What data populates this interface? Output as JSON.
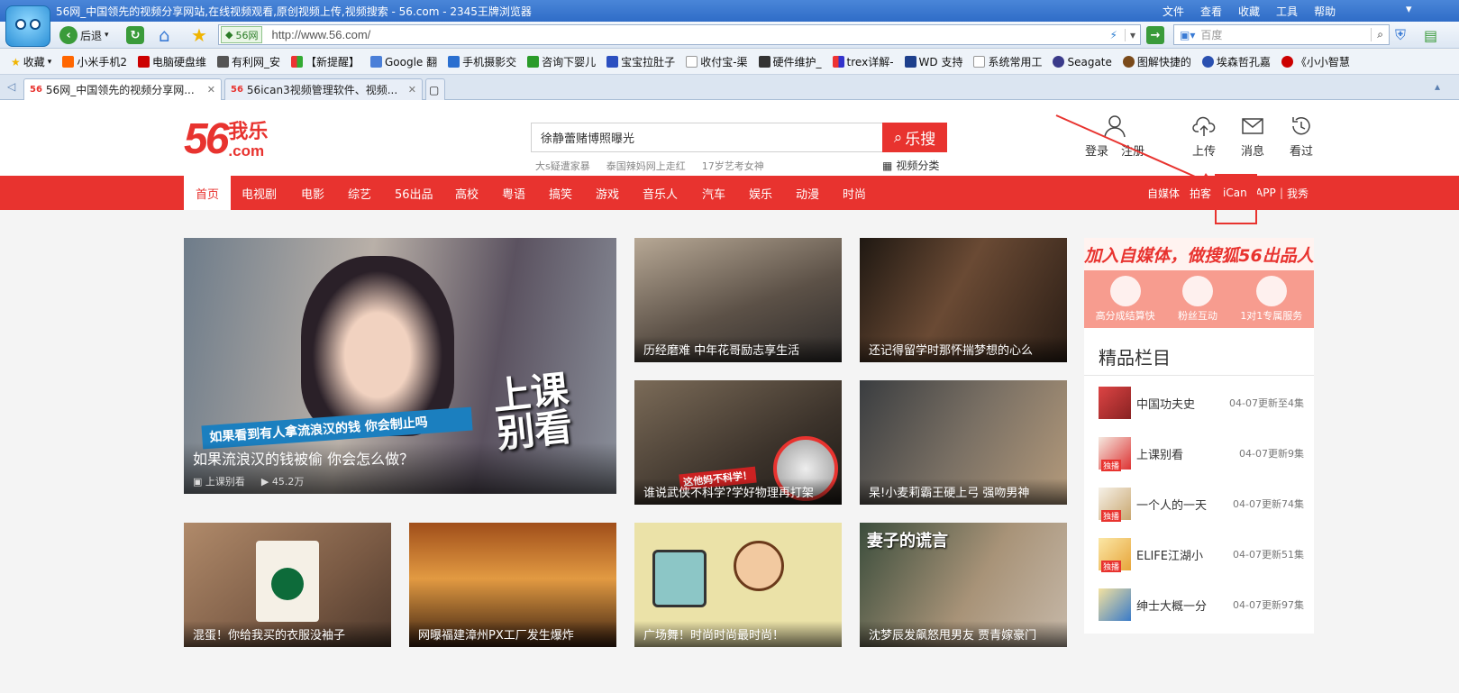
{
  "browser": {
    "title": "56网_中国领先的视频分享网站,在线视频观看,原创视频上传,视频搜索 - 56.com - 2345王牌浏览器",
    "menu": [
      "文件",
      "查看",
      "收藏",
      "工具",
      "帮助"
    ],
    "back_label": "后退",
    "site_label": "56网",
    "url": "http://www.56.com/",
    "search_placeholder": "百度",
    "bookmarks": [
      "收藏",
      "小米手机2",
      "电脑硬盘维",
      "有利网_安",
      "【新提醒】",
      "Google 翻",
      "手机摄影交",
      "咨询下婴儿",
      "宝宝拉肚子",
      "收付宝-渠",
      "硬件维护_",
      "trex详解-",
      "WD 支持",
      "系统常用工",
      "Seagate",
      "图解快捷的",
      "埃森哲孔嘉",
      "《小小智慧"
    ],
    "tabs": [
      {
        "label": "56网_中国领先的视频分享网...",
        "active": true
      },
      {
        "label": "56ican3视频管理软件、视频...",
        "active": false
      }
    ]
  },
  "site": {
    "logo_num": "56",
    "logo_cn": "我乐",
    "logo_com": ".com",
    "search_value": "徐静蕾赌博照曝光",
    "search_button": "乐搜",
    "hot_words": [
      "大s疑遭家暴",
      "泰国辣妈网上走红",
      "17岁艺考女神"
    ],
    "category_link": "视频分类",
    "user_actions": [
      "登录",
      "注册",
      "上传",
      "消息",
      "看过"
    ],
    "nav": [
      "首页",
      "电视剧",
      "电影",
      "综艺",
      "56出品",
      "高校",
      "粤语",
      "搞笑",
      "游戏",
      "音乐人",
      "汽车",
      "娱乐",
      "动漫",
      "时尚"
    ],
    "nav_right": [
      "自媒体",
      "拍客",
      "iCan",
      "APP",
      "我秀"
    ],
    "videos": {
      "big": {
        "title": "如果流浪汉的钱被偷 你会怎么做？",
        "banner": "如果看到有人拿流浪汉的钱 你会制止吗",
        "overlay": "上课别看",
        "channel": "上课别看",
        "views": "45.2万"
      },
      "v1": "历经磨难 中年花哥励志享生活",
      "v2": "还记得留学时那怀揣梦想的心么",
      "v3": "谁说武侠不科学?学好物理再打架",
      "v3_overlay": "这他妈不科学！",
      "v4": "杲!小麦莉霸王硬上弓 强吻男神",
      "v5": "混蛋！你给我买的衣服没袖子",
      "v6": "网曝福建漳州PX工厂发生爆炸",
      "v7": "广场舞！时尚时尚最时尚！",
      "v8": "沈梦辰发飙怒甩男友 贾青嫁豪门",
      "v8_overlay": "妻子的谎言"
    },
    "sidebar": {
      "ad_title": "加入自媒体，做搜狐56出品人",
      "ad_items": [
        "高分成结算快",
        "粉丝互动",
        "1对1专属服务"
      ],
      "heading": "精品栏目",
      "badge": "独播",
      "items": [
        {
          "title": "中国功夫史",
          "update": "04-07更新至4集",
          "exclusive": false
        },
        {
          "title": "上课别看",
          "update": "04-07更新9集",
          "exclusive": true
        },
        {
          "title": "一个人的一天",
          "update": "04-07更新74集",
          "exclusive": true
        },
        {
          "title": "ELIFE江湖小",
          "update": "04-07更新51集",
          "exclusive": true
        },
        {
          "title": "绅士大概一分",
          "update": "04-07更新97集",
          "exclusive": false
        }
      ]
    }
  },
  "colors": {
    "brand_red": "#e8332f",
    "chrome_blue": "#2f6cc7"
  }
}
